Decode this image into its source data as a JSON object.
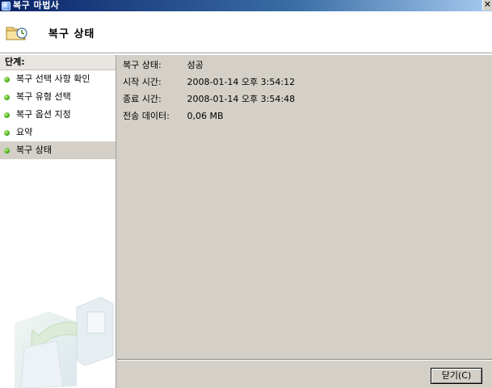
{
  "window": {
    "title": "복구 마법사",
    "close_glyph": "✕"
  },
  "header": {
    "title": "복구 상태",
    "icon": "folder-clock-icon"
  },
  "steps": {
    "heading": "단계:",
    "items": [
      {
        "label": "복구 선택 사항 확인",
        "active": false
      },
      {
        "label": "복구 유형 선택",
        "active": false
      },
      {
        "label": "복구 옵션 지정",
        "active": false
      },
      {
        "label": "요약",
        "active": false
      },
      {
        "label": "복구 상태",
        "active": true
      }
    ]
  },
  "status": {
    "rows": [
      {
        "label": "복구 상태:",
        "value": "성공"
      },
      {
        "label": "시작 시간:",
        "value": "2008-01-14 오후 3:54:12"
      },
      {
        "label": "종료 시간:",
        "value": "2008-01-14 오후 3:54:48"
      },
      {
        "label": "전송 데이터:",
        "value": "0,06 MB"
      }
    ]
  },
  "footer": {
    "close_label": "닫기(C)"
  },
  "colors": {
    "titlebar": "#0a246a",
    "panel_bg": "#d4d0c8",
    "step_dot": "#4caf1e"
  }
}
